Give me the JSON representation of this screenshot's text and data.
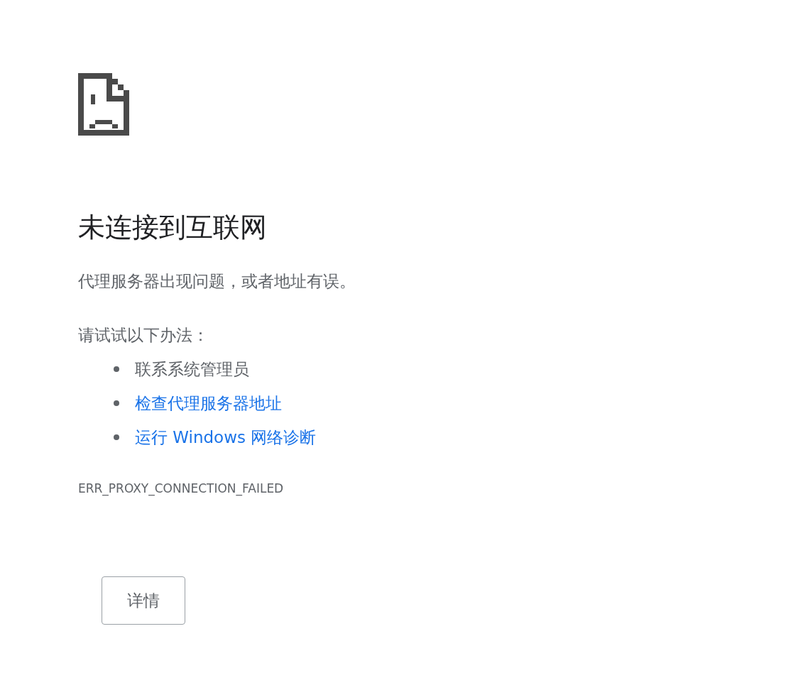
{
  "title": "未连接到互联网",
  "description": "代理服务器出现问题，或者地址有误。",
  "suggestions_heading": "请试试以下办法：",
  "suggestions": [
    {
      "kind": "text",
      "label": "联系系统管理员"
    },
    {
      "kind": "link",
      "label": "检查代理服务器地址"
    },
    {
      "kind": "link",
      "label": "运行 Windows 网络诊断"
    }
  ],
  "error_code": "ERR_PROXY_CONNECTION_FAILED",
  "details_button": "详情"
}
